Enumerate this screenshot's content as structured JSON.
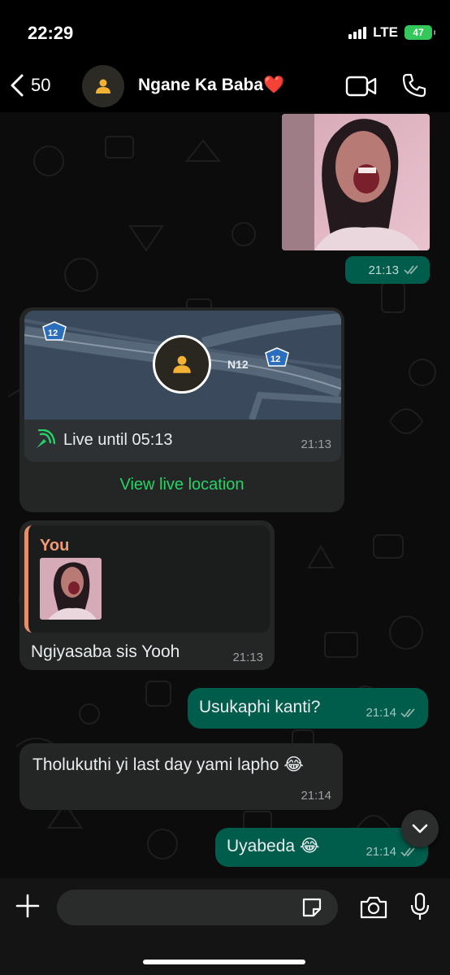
{
  "status": {
    "time": "22:29",
    "network": "LTE",
    "battery": "47"
  },
  "header": {
    "back_count": "50",
    "contact_name": "Ngane Ka Baba❤️"
  },
  "messages": {
    "photo_time": "21:13",
    "location": {
      "road_label": "N12",
      "shield_label": "12",
      "live_text": "Live until 05:13",
      "time": "21:13",
      "view_label": "View live location"
    },
    "reply": {
      "quote_author": "You",
      "text": "Ngiyasaba sis Yooh",
      "time": "21:13"
    },
    "out1": {
      "text": "Usukaphi kanti?",
      "time": "21:14"
    },
    "in2": {
      "text": "Tholukuthi yi last day yami lapho 😂",
      "time": "21:14"
    },
    "out2": {
      "text": "Uyabeda 😂",
      "time": "21:14"
    }
  },
  "composer": {
    "placeholder": ""
  },
  "colors": {
    "outgoing": "#005c4b",
    "incoming": "#242626",
    "accent": "#25d366",
    "quote_bar": "#e5906a"
  },
  "icons": [
    "back-chevron-icon",
    "person-icon",
    "video-camera-icon",
    "phone-icon",
    "live-location-icon",
    "double-check-icon",
    "chevron-down-icon",
    "plus-icon",
    "sticker-icon",
    "camera-icon",
    "microphone-icon"
  ]
}
